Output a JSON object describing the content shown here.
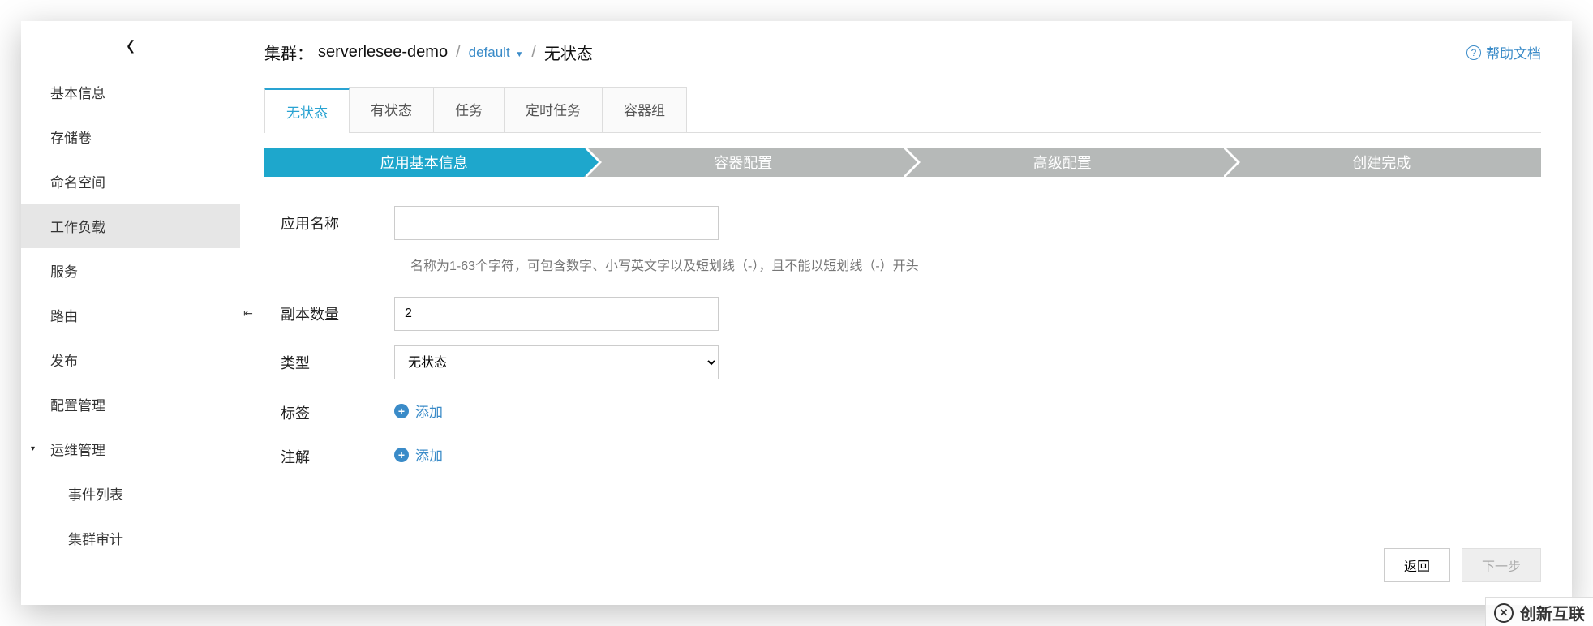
{
  "sidebar": {
    "items": [
      {
        "label": "基本信息"
      },
      {
        "label": "存储卷"
      },
      {
        "label": "命名空间"
      },
      {
        "label": "工作负载"
      },
      {
        "label": "服务"
      },
      {
        "label": "路由"
      },
      {
        "label": "发布"
      },
      {
        "label": "配置管理"
      },
      {
        "label": "运维管理"
      }
    ],
    "ops_children": [
      {
        "label": "事件列表"
      },
      {
        "label": "集群审计"
      }
    ],
    "active_index": 3
  },
  "breadcrumb": {
    "prefix": "集群：",
    "cluster": "serverlesee-demo",
    "namespace": "default",
    "resource": "无状态"
  },
  "help_label": "帮助文档",
  "tabs": {
    "items": [
      "无状态",
      "有状态",
      "任务",
      "定时任务",
      "容器组"
    ],
    "active_index": 0
  },
  "steps": {
    "items": [
      "应用基本信息",
      "容器配置",
      "高级配置",
      "创建完成"
    ],
    "active_index": 0
  },
  "form": {
    "app_name": {
      "label": "应用名称",
      "value": "",
      "hint": "名称为1-63个字符，可包含数字、小写英文字以及短划线（-），且不能以短划线（-）开头"
    },
    "replicas": {
      "label": "副本数量",
      "value": "2"
    },
    "type": {
      "label": "类型",
      "selected": "无状态",
      "options": [
        "无状态"
      ]
    },
    "labels": {
      "label": "标签",
      "add_text": "添加"
    },
    "annotations": {
      "label": "注解",
      "add_text": "添加"
    }
  },
  "footer": {
    "back": "返回",
    "next": "下一步"
  },
  "watermark": "创新互联"
}
